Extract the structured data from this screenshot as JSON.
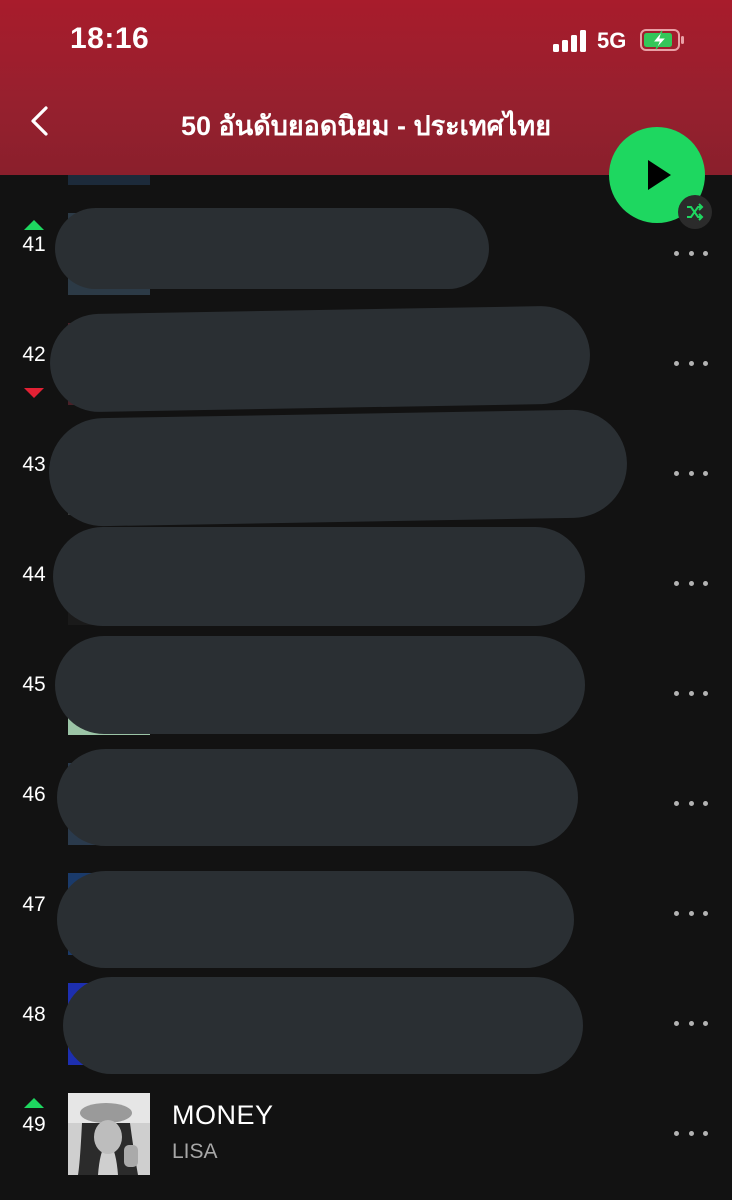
{
  "status_bar": {
    "time": "18:16",
    "network": "5G"
  },
  "header": {
    "title": "50 อันดับยอดนิยม - ประเทศไทย"
  },
  "colors": {
    "accent_green": "#1ed760",
    "header_red": "#a81c2c",
    "trend_down": "#e22134",
    "redaction": "#2a2f33"
  },
  "tracks": [
    {
      "rank": "41",
      "trend": "up",
      "redacted": true
    },
    {
      "rank": "42",
      "trend": "down",
      "redacted": true
    },
    {
      "rank": "43",
      "trend": "none",
      "redacted": true
    },
    {
      "rank": "44",
      "trend": "none",
      "redacted": true
    },
    {
      "rank": "45",
      "trend": "none",
      "redacted": true
    },
    {
      "rank": "46",
      "trend": "none",
      "redacted": true
    },
    {
      "rank": "47",
      "trend": "none",
      "redacted": true
    },
    {
      "rank": "48",
      "trend": "none",
      "redacted": true
    },
    {
      "rank": "49",
      "trend": "up",
      "title": "MONEY",
      "artist": "LISA"
    }
  ],
  "icons": {
    "back": "chevron-left-icon",
    "play": "play-icon",
    "shuffle": "shuffle-icon",
    "more": "more-horizontal-icon"
  }
}
